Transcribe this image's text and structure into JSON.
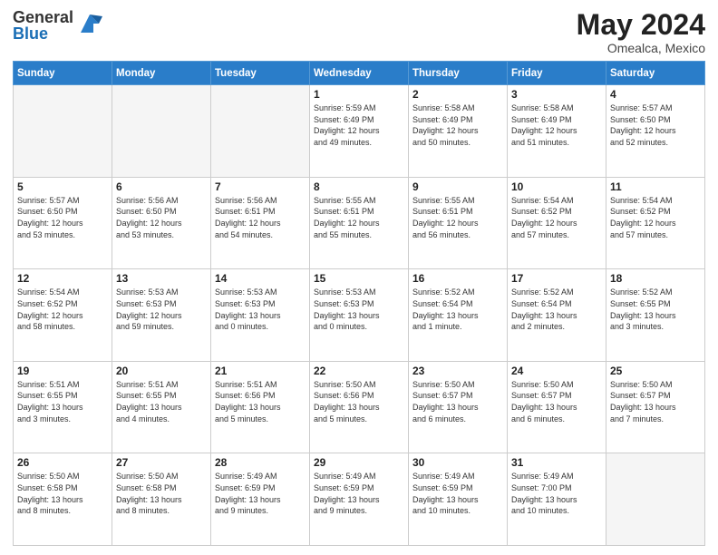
{
  "logo": {
    "general": "General",
    "blue": "Blue"
  },
  "header": {
    "month": "May 2024",
    "location": "Omealca, Mexico"
  },
  "weekdays": [
    "Sunday",
    "Monday",
    "Tuesday",
    "Wednesday",
    "Thursday",
    "Friday",
    "Saturday"
  ],
  "weeks": [
    [
      {
        "day": "",
        "info": ""
      },
      {
        "day": "",
        "info": ""
      },
      {
        "day": "",
        "info": ""
      },
      {
        "day": "1",
        "info": "Sunrise: 5:59 AM\nSunset: 6:49 PM\nDaylight: 12 hours\nand 49 minutes."
      },
      {
        "day": "2",
        "info": "Sunrise: 5:58 AM\nSunset: 6:49 PM\nDaylight: 12 hours\nand 50 minutes."
      },
      {
        "day": "3",
        "info": "Sunrise: 5:58 AM\nSunset: 6:49 PM\nDaylight: 12 hours\nand 51 minutes."
      },
      {
        "day": "4",
        "info": "Sunrise: 5:57 AM\nSunset: 6:50 PM\nDaylight: 12 hours\nand 52 minutes."
      }
    ],
    [
      {
        "day": "5",
        "info": "Sunrise: 5:57 AM\nSunset: 6:50 PM\nDaylight: 12 hours\nand 53 minutes."
      },
      {
        "day": "6",
        "info": "Sunrise: 5:56 AM\nSunset: 6:50 PM\nDaylight: 12 hours\nand 53 minutes."
      },
      {
        "day": "7",
        "info": "Sunrise: 5:56 AM\nSunset: 6:51 PM\nDaylight: 12 hours\nand 54 minutes."
      },
      {
        "day": "8",
        "info": "Sunrise: 5:55 AM\nSunset: 6:51 PM\nDaylight: 12 hours\nand 55 minutes."
      },
      {
        "day": "9",
        "info": "Sunrise: 5:55 AM\nSunset: 6:51 PM\nDaylight: 12 hours\nand 56 minutes."
      },
      {
        "day": "10",
        "info": "Sunrise: 5:54 AM\nSunset: 6:52 PM\nDaylight: 12 hours\nand 57 minutes."
      },
      {
        "day": "11",
        "info": "Sunrise: 5:54 AM\nSunset: 6:52 PM\nDaylight: 12 hours\nand 57 minutes."
      }
    ],
    [
      {
        "day": "12",
        "info": "Sunrise: 5:54 AM\nSunset: 6:52 PM\nDaylight: 12 hours\nand 58 minutes."
      },
      {
        "day": "13",
        "info": "Sunrise: 5:53 AM\nSunset: 6:53 PM\nDaylight: 12 hours\nand 59 minutes."
      },
      {
        "day": "14",
        "info": "Sunrise: 5:53 AM\nSunset: 6:53 PM\nDaylight: 13 hours\nand 0 minutes."
      },
      {
        "day": "15",
        "info": "Sunrise: 5:53 AM\nSunset: 6:53 PM\nDaylight: 13 hours\nand 0 minutes."
      },
      {
        "day": "16",
        "info": "Sunrise: 5:52 AM\nSunset: 6:54 PM\nDaylight: 13 hours\nand 1 minute."
      },
      {
        "day": "17",
        "info": "Sunrise: 5:52 AM\nSunset: 6:54 PM\nDaylight: 13 hours\nand 2 minutes."
      },
      {
        "day": "18",
        "info": "Sunrise: 5:52 AM\nSunset: 6:55 PM\nDaylight: 13 hours\nand 3 minutes."
      }
    ],
    [
      {
        "day": "19",
        "info": "Sunrise: 5:51 AM\nSunset: 6:55 PM\nDaylight: 13 hours\nand 3 minutes."
      },
      {
        "day": "20",
        "info": "Sunrise: 5:51 AM\nSunset: 6:55 PM\nDaylight: 13 hours\nand 4 minutes."
      },
      {
        "day": "21",
        "info": "Sunrise: 5:51 AM\nSunset: 6:56 PM\nDaylight: 13 hours\nand 5 minutes."
      },
      {
        "day": "22",
        "info": "Sunrise: 5:50 AM\nSunset: 6:56 PM\nDaylight: 13 hours\nand 5 minutes."
      },
      {
        "day": "23",
        "info": "Sunrise: 5:50 AM\nSunset: 6:57 PM\nDaylight: 13 hours\nand 6 minutes."
      },
      {
        "day": "24",
        "info": "Sunrise: 5:50 AM\nSunset: 6:57 PM\nDaylight: 13 hours\nand 6 minutes."
      },
      {
        "day": "25",
        "info": "Sunrise: 5:50 AM\nSunset: 6:57 PM\nDaylight: 13 hours\nand 7 minutes."
      }
    ],
    [
      {
        "day": "26",
        "info": "Sunrise: 5:50 AM\nSunset: 6:58 PM\nDaylight: 13 hours\nand 8 minutes."
      },
      {
        "day": "27",
        "info": "Sunrise: 5:50 AM\nSunset: 6:58 PM\nDaylight: 13 hours\nand 8 minutes."
      },
      {
        "day": "28",
        "info": "Sunrise: 5:49 AM\nSunset: 6:59 PM\nDaylight: 13 hours\nand 9 minutes."
      },
      {
        "day": "29",
        "info": "Sunrise: 5:49 AM\nSunset: 6:59 PM\nDaylight: 13 hours\nand 9 minutes."
      },
      {
        "day": "30",
        "info": "Sunrise: 5:49 AM\nSunset: 6:59 PM\nDaylight: 13 hours\nand 10 minutes."
      },
      {
        "day": "31",
        "info": "Sunrise: 5:49 AM\nSunset: 7:00 PM\nDaylight: 13 hours\nand 10 minutes."
      },
      {
        "day": "",
        "info": ""
      }
    ]
  ]
}
